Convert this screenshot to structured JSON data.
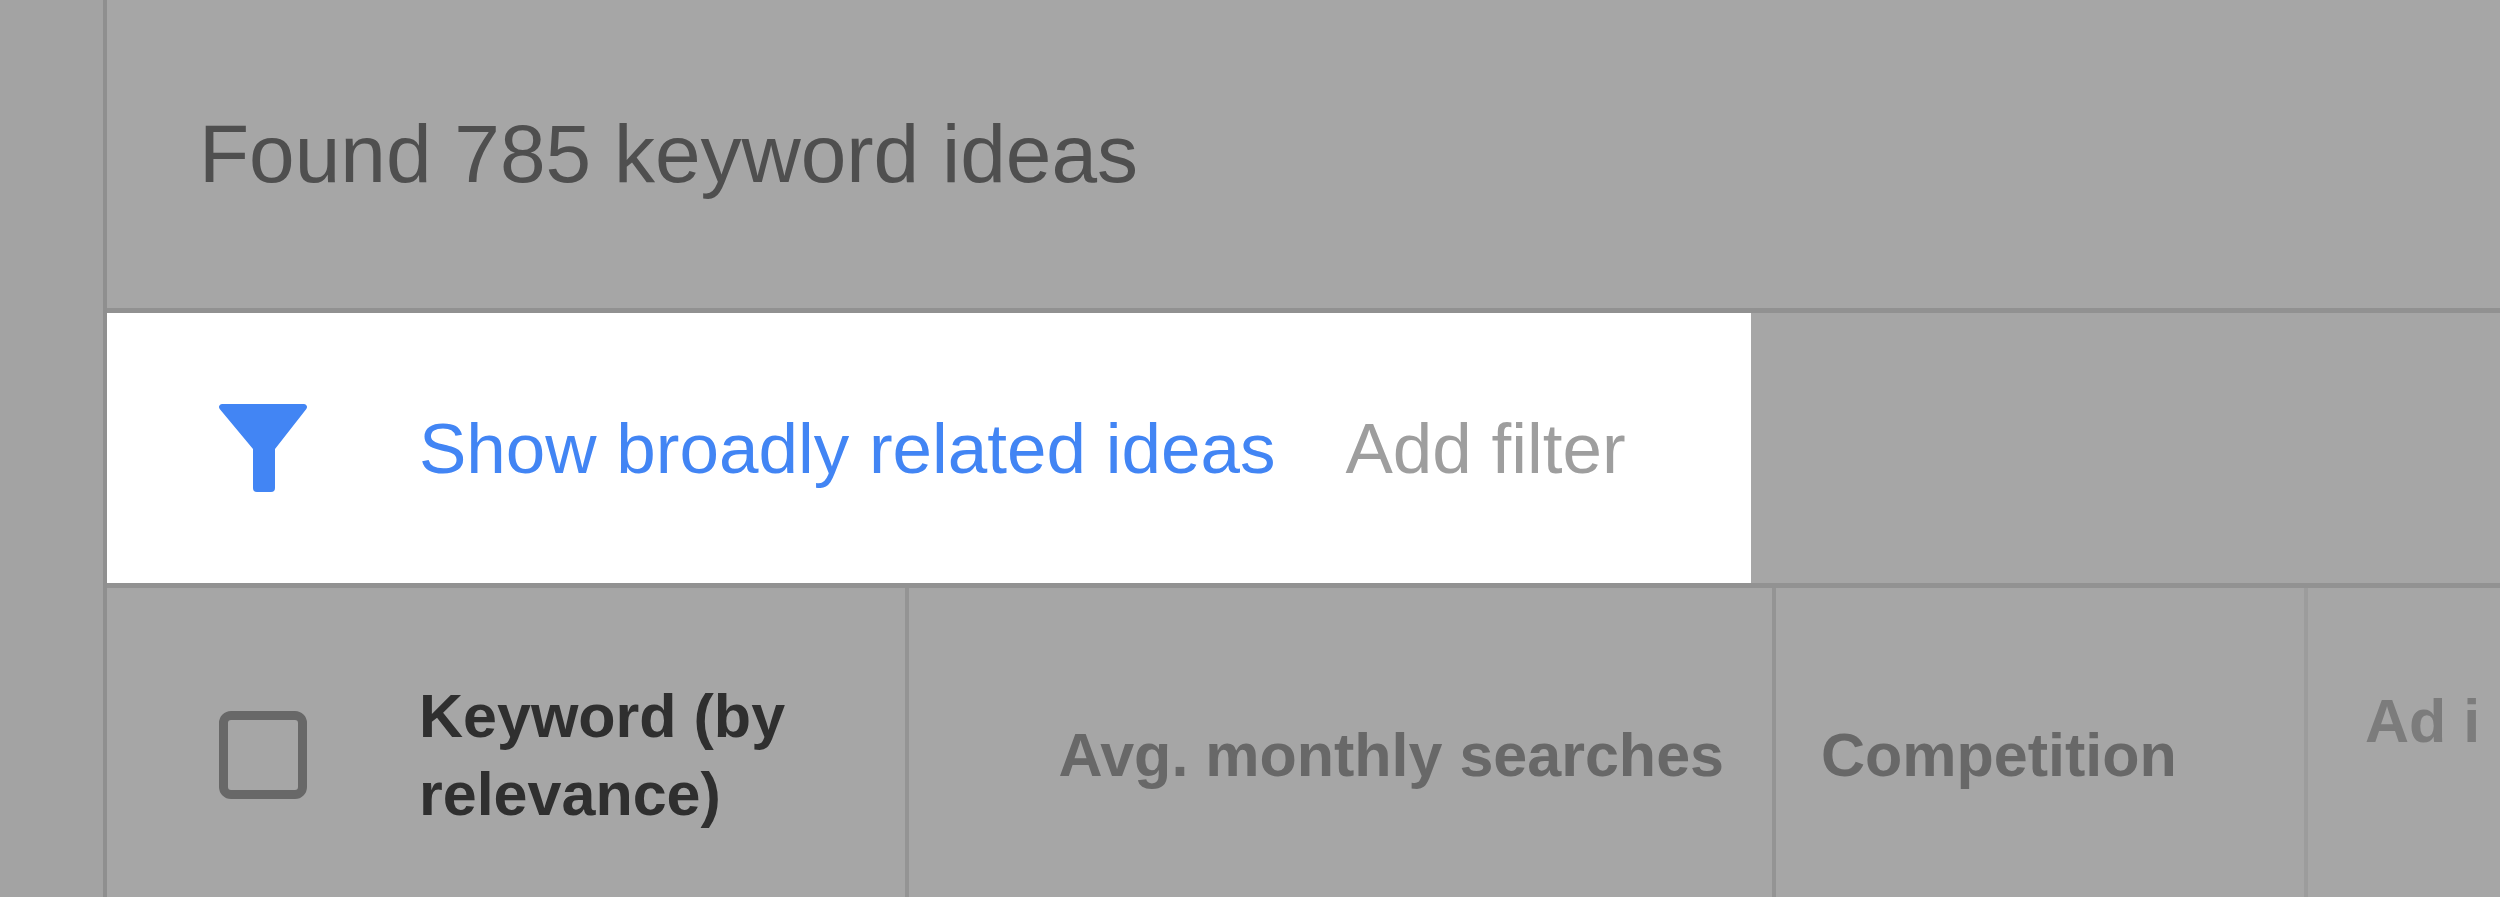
{
  "header": {
    "title": "Found 785 keyword ideas"
  },
  "filter_bar": {
    "link": "Show broadly related ideas",
    "add_filter": "Add filter"
  },
  "table": {
    "select_all": {
      "checked": false
    },
    "columns": [
      {
        "label": "Keyword (by relevance)",
        "sorted": true
      },
      {
        "label": "Avg. monthly searches",
        "sorted": false
      },
      {
        "label": "Competition",
        "sorted": false
      },
      {
        "label": "Ad i",
        "sorted": false
      }
    ]
  }
}
